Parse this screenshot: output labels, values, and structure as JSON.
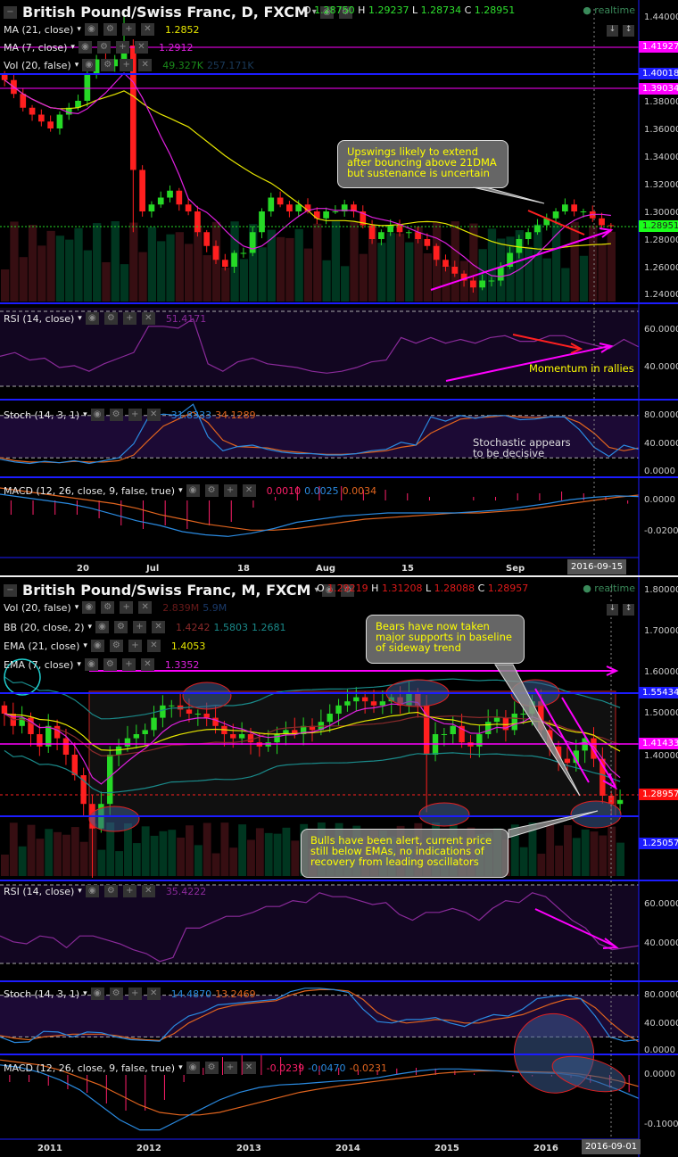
{
  "colors": {
    "up": "#26d926",
    "down": "#ff1f1f",
    "ma21": "#e6e600",
    "ma7": "#e020e0",
    "rsi": "#8a2a9a",
    "stochK": "#2a8ae0",
    "stochD": "#e0641e",
    "macd": "#2a8ae0",
    "signal": "#e0641e",
    "hist": "#ff1f6a",
    "blue": "#1c1cff",
    "magenta": "#ff00ff"
  },
  "daily": {
    "title": "British Pound/Swiss Franc, D, FXCM",
    "ohlc": {
      "o_label": "O",
      "o": "1.28750",
      "h_label": "H",
      "h": "1.29237",
      "l_label": "L",
      "l": "1.28734",
      "c_label": "C",
      "c": "1.28951"
    },
    "realtime": "realtime",
    "legends": [
      {
        "label": "MA (21, close)",
        "values": [
          "1.2852"
        ]
      },
      {
        "label": "MA (7, close)",
        "values": [
          "1.2912"
        ]
      },
      {
        "label": "Vol (20, false)",
        "values": [
          "49.327K",
          "257.171K"
        ]
      }
    ],
    "price_axis": [
      "1.44000",
      "1.38000",
      "1.36000",
      "1.34000",
      "1.32000",
      "1.30000",
      "1.28000",
      "1.26000",
      "1.24000"
    ],
    "price_tags": [
      "1.41927",
      "1.40018",
      "1.39034",
      "1.28951"
    ],
    "rsi": {
      "label": "RSI (14, close)",
      "value": "51.4171",
      "axis": [
        "60.0000",
        "40.0000"
      ]
    },
    "stoch": {
      "label": "Stoch (14, 3, 1)",
      "k": "31.8333",
      "d": "34.1289",
      "axis": [
        "80.0000",
        "40.0000",
        "0.0000"
      ]
    },
    "macd": {
      "label": "MACD (12, 26, close, 9, false, true)",
      "values": [
        "0.0010",
        "0.0025",
        "0.0034"
      ],
      "axis": [
        "0.0000",
        "-0.0200"
      ]
    },
    "time_axis": [
      "20",
      "Jul",
      "18",
      "Aug",
      "15",
      "Sep"
    ],
    "current_date": "2016-09-15",
    "callout": "Upswings likely to extend after bouncing above 21DMA but sustenance is uncertain",
    "note_rsi": "Momentum in rallies",
    "note_stoch": "Stochastic appears to be decisive"
  },
  "monthly": {
    "title": "British Pound/Swiss Franc, M, FXCM",
    "ohlc": {
      "o_label": "O",
      "o": "1.29219",
      "h_label": "H",
      "h": "1.31208",
      "l_label": "L",
      "l": "1.28088",
      "c_label": "C",
      "c": "1.28957"
    },
    "realtime": "realtime",
    "legends": [
      {
        "label": "Vol (20, false)",
        "values": [
          "2.839M",
          "5.9M"
        ]
      },
      {
        "label": "BB (20, close, 2)",
        "values": [
          "1.4242",
          "1.5803",
          "1.2681"
        ]
      },
      {
        "label": "EMA (21, close)",
        "values": [
          "1.4053"
        ]
      },
      {
        "label": "EMA (7, close)",
        "values": [
          "1.3352"
        ]
      }
    ],
    "price_axis": [
      "1.80000",
      "1.70000",
      "1.60000",
      "1.50000",
      "1.40000"
    ],
    "price_tags": [
      "1.55434",
      "1.41433",
      "1.28957",
      "1.25057"
    ],
    "rsi": {
      "label": "RSI (14, close)",
      "value": "35.4222",
      "axis": [
        "60.0000",
        "40.0000"
      ]
    },
    "stoch": {
      "label": "Stoch (14, 3, 1)",
      "k": "14.4870",
      "d": "13.2469",
      "axis": [
        "80.0000",
        "40.0000",
        "0.0000"
      ]
    },
    "macd": {
      "label": "MACD (12, 26, close, 9, false, true)",
      "values": [
        "-0.0239",
        "-0.0470",
        "-0.0231"
      ],
      "axis": [
        "0.0000",
        "-0.1000"
      ]
    },
    "time_axis": [
      "2011",
      "2012",
      "2013",
      "2014",
      "2015",
      "2016"
    ],
    "current_date": "2016-09-01",
    "callout1": "Bears have now taken major supports in baseline of sideway trend",
    "callout2": "Bulls have been alert, current price still below EMAs, no indications of recovery from leading oscillators"
  },
  "chart_data": [
    {
      "type": "candlestick",
      "title": "British Pound/Swiss Franc, D, FXCM",
      "ylim": [
        1.23,
        1.45
      ],
      "open0": 1.4,
      "closes": [
        1.395,
        1.385,
        1.375,
        1.37,
        1.365,
        1.36,
        1.37,
        1.375,
        1.38,
        1.4,
        1.41,
        1.405,
        1.41,
        1.42,
        1.33,
        1.3,
        1.305,
        1.31,
        1.315,
        1.305,
        1.3,
        1.285,
        1.275,
        1.265,
        1.26,
        1.27,
        1.27,
        1.285,
        1.3,
        1.31,
        1.305,
        1.3,
        1.305,
        1.3,
        1.295,
        1.3,
        1.3,
        1.305,
        1.3,
        1.29,
        1.28,
        1.285,
        1.29,
        1.285,
        1.285,
        1.28,
        1.275,
        1.265,
        1.26,
        1.255,
        1.25,
        1.245,
        1.25,
        1.25,
        1.26,
        1.27,
        1.28,
        1.285,
        1.29,
        1.295,
        1.3,
        1.305,
        1.3,
        1.3,
        1.295,
        1.29,
        1.2895
      ],
      "spikes": [
        {
          "index": 13,
          "high": 1.445
        },
        {
          "index": 14,
          "low": 1.285
        }
      ],
      "rsi": [
        46,
        48,
        44,
        45,
        40,
        41,
        38,
        42,
        45,
        48,
        62,
        62,
        61,
        66,
        42,
        38,
        43,
        45,
        42,
        41,
        40,
        38,
        37,
        38,
        40,
        43,
        44,
        56,
        53,
        56,
        53,
        55,
        53,
        56,
        57,
        54,
        54,
        57,
        57,
        54,
        52,
        50,
        55,
        51
      ],
      "stoch_k": [
        18,
        14,
        12,
        15,
        13,
        16,
        12,
        16,
        20,
        40,
        78,
        82,
        80,
        96,
        50,
        30,
        36,
        38,
        32,
        28,
        26,
        26,
        24,
        24,
        26,
        30,
        32,
        42,
        38,
        78,
        72,
        80,
        76,
        80,
        80,
        74,
        75,
        78,
        78,
        60,
        35,
        22,
        38,
        32
      ],
      "stoch_d": [
        20,
        16,
        14,
        14,
        13,
        15,
        14,
        14,
        16,
        24,
        45,
        65,
        75,
        85,
        70,
        45,
        36,
        35,
        34,
        30,
        28,
        26,
        25,
        25,
        26,
        28,
        30,
        35,
        38,
        55,
        65,
        75,
        77,
        78,
        80,
        78,
        77,
        78,
        78,
        70,
        55,
        35,
        30,
        34
      ],
      "macd": [
        0.004,
        0.002,
        0,
        -0.002,
        -0.005,
        -0.009,
        -0.013,
        -0.016,
        -0.02,
        -0.022,
        -0.023,
        -0.021,
        -0.018,
        -0.014,
        -0.012,
        -0.01,
        -0.009,
        -0.008,
        -0.008,
        -0.008,
        -0.008,
        -0.007,
        -0.006,
        -0.004,
        -0.002,
        0.0005,
        0.002,
        0.003,
        0.0025
      ],
      "signal": [
        0.008,
        0.006,
        0.004,
        0.002,
        0,
        -0.002,
        -0.005,
        -0.009,
        -0.012,
        -0.015,
        -0.017,
        -0.019,
        -0.019,
        -0.018,
        -0.016,
        -0.014,
        -0.012,
        -0.011,
        -0.01,
        -0.009,
        -0.008,
        -0.008,
        -0.007,
        -0.006,
        -0.004,
        -0.002,
        0,
        0.002,
        0.0034
      ]
    },
    {
      "type": "candlestick",
      "title": "British Pound/Swiss Franc, M, FXCM",
      "ylim": [
        1.1,
        1.82
      ],
      "open0": 1.52,
      "closes": [
        1.5,
        1.47,
        1.49,
        1.45,
        1.42,
        1.47,
        1.44,
        1.4,
        1.35,
        1.28,
        1.22,
        1.28,
        1.4,
        1.42,
        1.44,
        1.45,
        1.46,
        1.49,
        1.52,
        1.52,
        1.51,
        1.5,
        1.5,
        1.49,
        1.47,
        1.45,
        1.44,
        1.45,
        1.43,
        1.42,
        1.43,
        1.45,
        1.46,
        1.45,
        1.47,
        1.46,
        1.48,
        1.5,
        1.52,
        1.53,
        1.54,
        1.53,
        1.52,
        1.53,
        1.54,
        1.52,
        1.55,
        1.52,
        1.4,
        1.45,
        1.45,
        1.47,
        1.43,
        1.42,
        1.45,
        1.48,
        1.49,
        1.46,
        1.5,
        1.5,
        1.53,
        1.46,
        1.42,
        1.39,
        1.38,
        1.41,
        1.44,
        1.39,
        1.3,
        1.28,
        1.2896
      ],
      "spikes": [
        {
          "index": 10,
          "low": 1.1
        },
        {
          "index": 48,
          "low": 1.26
        }
      ],
      "rsi": [
        44,
        41,
        40,
        44,
        43,
        38,
        44,
        44,
        42,
        40,
        37,
        35,
        31,
        33,
        48,
        48,
        51,
        54,
        54,
        56,
        59,
        59,
        62,
        61,
        66,
        64,
        64,
        62,
        60,
        61,
        55,
        52,
        56,
        56,
        58,
        56,
        52,
        58,
        62,
        61,
        66,
        64,
        58,
        52,
        48,
        40,
        37,
        38,
        39
      ],
      "stoch_k": [
        20,
        12,
        13,
        28,
        27,
        20,
        27,
        26,
        20,
        16,
        15,
        14,
        36,
        50,
        56,
        66,
        68,
        70,
        72,
        74,
        85,
        90,
        90,
        88,
        84,
        60,
        42,
        40,
        45,
        45,
        48,
        40,
        35,
        45,
        52,
        50,
        60,
        75,
        78,
        80,
        75,
        50,
        20,
        14,
        16
      ],
      "stoch_d": [
        22,
        18,
        16,
        20,
        22,
        24,
        24,
        24,
        22,
        18,
        16,
        15,
        25,
        40,
        50,
        60,
        65,
        68,
        70,
        72,
        80,
        86,
        88,
        88,
        86,
        74,
        55,
        44,
        40,
        42,
        45,
        44,
        40,
        40,
        45,
        48,
        52,
        60,
        68,
        74,
        75,
        62,
        42,
        25,
        13
      ],
      "macd": [
        0.02,
        0.015,
        0.005,
        -0.01,
        -0.03,
        -0.06,
        -0.09,
        -0.11,
        -0.11,
        -0.09,
        -0.07,
        -0.05,
        -0.035,
        -0.025,
        -0.02,
        -0.018,
        -0.015,
        -0.012,
        -0.01,
        -0.005,
        0.002,
        0.008,
        0.012,
        0.012,
        0.01,
        0.008,
        0.005,
        0.004,
        0.003,
        -0.002,
        -0.015,
        -0.03,
        -0.047
      ],
      "signal": [
        0.03,
        0.025,
        0.02,
        0.01,
        -0.005,
        -0.02,
        -0.04,
        -0.06,
        -0.075,
        -0.08,
        -0.08,
        -0.075,
        -0.065,
        -0.055,
        -0.045,
        -0.035,
        -0.028,
        -0.022,
        -0.017,
        -0.012,
        -0.007,
        -0.002,
        0.003,
        0.006,
        0.008,
        0.008,
        0.007,
        0.006,
        0.005,
        0.002,
        -0.004,
        -0.012,
        -0.023
      ]
    }
  ]
}
